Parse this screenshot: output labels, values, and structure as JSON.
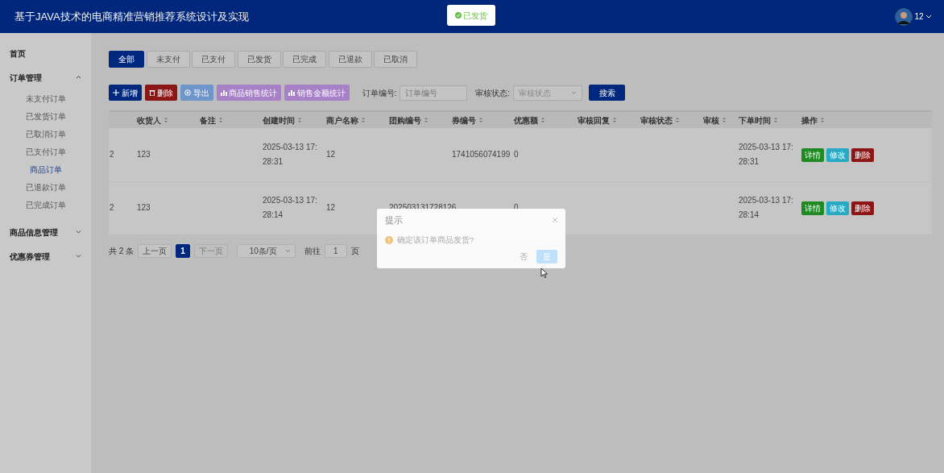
{
  "header": {
    "title": "基于JAVA技术的电商精准营销推荐系统设计及实现",
    "toast": {
      "text": "已发货",
      "kind": "success"
    },
    "user": {
      "name": "12"
    }
  },
  "sidebar": {
    "items": [
      {
        "label": "首页"
      },
      {
        "label": "订单管理",
        "expanded": true,
        "children": [
          {
            "label": "未支付订单",
            "selected": false
          },
          {
            "label": "已发货订单",
            "selected": false
          },
          {
            "label": "已取消订单",
            "selected": false
          },
          {
            "label": "已支付订单",
            "selected": false
          },
          {
            "label": "商品订单",
            "selected": true
          },
          {
            "label": "已退款订单",
            "selected": false
          },
          {
            "label": "已完成订单",
            "selected": false
          }
        ]
      },
      {
        "label": "商品信息管理",
        "expanded": false
      },
      {
        "label": "优惠券管理",
        "expanded": false
      }
    ]
  },
  "status_tabs": [
    {
      "label": "全部",
      "selected": true
    },
    {
      "label": "未支付",
      "selected": false
    },
    {
      "label": "已支付",
      "selected": false
    },
    {
      "label": "已发货",
      "selected": false
    },
    {
      "label": "已完成",
      "selected": false
    },
    {
      "label": "已退款",
      "selected": false
    },
    {
      "label": "已取消",
      "selected": false
    }
  ],
  "toolbar": {
    "buttons": [
      {
        "label": "新增",
        "kind": "add"
      },
      {
        "label": "删除",
        "kind": "delete"
      },
      {
        "label": "导出",
        "kind": "export"
      },
      {
        "label": "商品销售统计",
        "kind": "stats"
      },
      {
        "label": "销售金额统计",
        "kind": "stats"
      }
    ],
    "filters": [
      {
        "label": "订单编号:",
        "placeholder": "订单编号",
        "kind": "input"
      },
      {
        "label": "审核状态:",
        "placeholder": "审核状态",
        "kind": "select"
      }
    ],
    "search_button": "搜索"
  },
  "table": {
    "columns": [
      "收货人",
      "备注",
      "创建时间",
      "商户名称",
      "团购编号",
      "券编号",
      "优惠额",
      "审核回复",
      "审核状态",
      "审核",
      "下单时间",
      "操作"
    ],
    "rows": [
      {
        "number": "2",
        "consignee": "123",
        "created": "2025-03-13 17:28:31",
        "merchant": "12",
        "coupon_no": "1741056074199",
        "discount": "0",
        "order_time": "2025-03-13 17:28:31",
        "actions": [
          {
            "label": "详情",
            "kind": "detail"
          },
          {
            "label": "修改",
            "kind": "edit"
          },
          {
            "label": "删除",
            "kind": "delete"
          }
        ]
      },
      {
        "number": "2",
        "consignee": "123",
        "created": "2025-03-13 17:28:14",
        "merchant": "12",
        "group_no": "202503131728126",
        "discount": "0",
        "order_time": "2025-03-13 17:28:14",
        "actions": [
          {
            "label": "详情",
            "kind": "detail"
          },
          {
            "label": "修改",
            "kind": "edit"
          },
          {
            "label": "删除",
            "kind": "delete"
          }
        ]
      }
    ]
  },
  "pagination": {
    "total": "共 2 条",
    "prev": "上一页",
    "pages": [
      {
        "label": "1",
        "selected": true
      }
    ],
    "next": "下一页",
    "next_disabled": true,
    "page_size": "10条/页",
    "goto_label": "前往",
    "goto_value": "1",
    "page_unit": "页"
  },
  "dialog": {
    "title": "提示",
    "message": "确定该订单商品发货?",
    "cancel": "否",
    "confirm": "是"
  }
}
